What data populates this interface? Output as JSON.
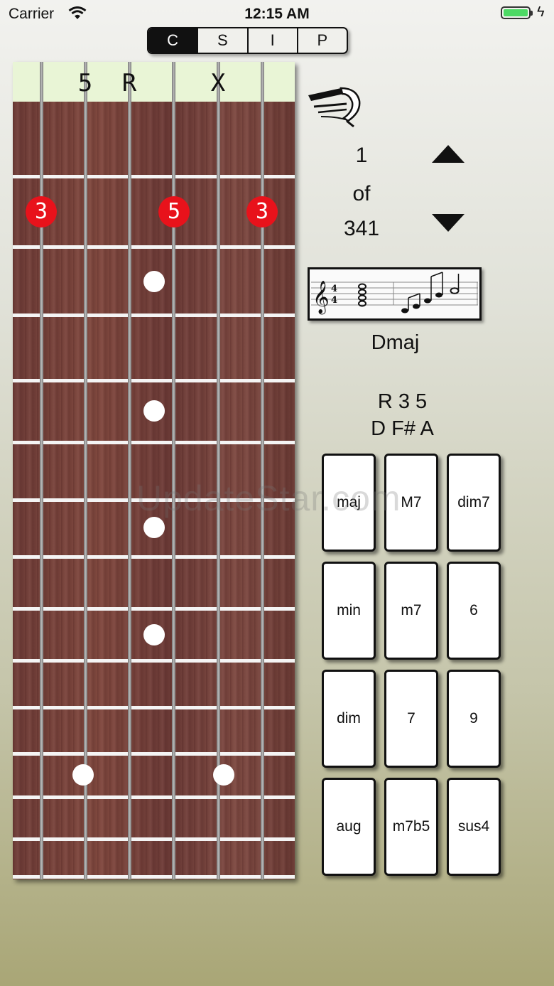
{
  "status_bar": {
    "carrier": "Carrier",
    "time": "12:15 AM"
  },
  "segments": [
    {
      "label": "C",
      "active": true
    },
    {
      "label": "S",
      "active": false
    },
    {
      "label": "I",
      "active": false
    },
    {
      "label": "P",
      "active": false
    }
  ],
  "fretboard": {
    "string_markers": [
      "5",
      "R",
      "X"
    ],
    "fingers": [
      "3",
      "5",
      "3"
    ]
  },
  "voicing": {
    "current": "1",
    "of_label": "of",
    "total": "341"
  },
  "chord": {
    "name": "Dmaj",
    "intervals": "R 3 5",
    "notes": "D F# A"
  },
  "chord_types": [
    "maj",
    "M7",
    "dim7",
    "min",
    "m7",
    "6",
    "dim",
    "7",
    "9",
    "aug",
    "m7b5",
    "sus4"
  ],
  "watermark": "UpdateStar.com",
  "colors": {
    "finger_dot": "#e8121b",
    "nut": "#e9f5d6",
    "active_segment": "#111111"
  }
}
